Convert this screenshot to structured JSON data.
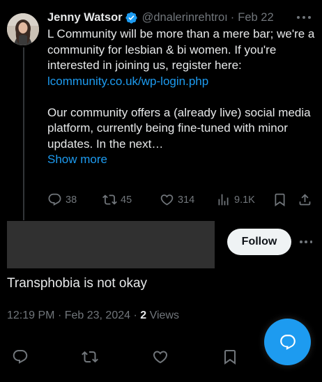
{
  "post": {
    "author_name": "Jenny Watsor",
    "handle": "@dnalerinrehtroı",
    "separator": "·",
    "date": "Feb 22",
    "verified_icon": "verified-badge-icon",
    "body_line_1": "L Community will be more than a mere bar; we're a community for lesbian & bi women. If you're interested in joining us, register here:",
    "link": "lcommunity.co.uk/wp-login.php",
    "body_line_2": "Our community offers a (already live) social media platform, currently being fine-tuned with minor updates. In the next…",
    "show_more": "Show more",
    "actions": {
      "replies": "38",
      "reposts": "45",
      "likes": "314",
      "views": "9.1K"
    }
  },
  "reply": {
    "follow_label": "Follow",
    "text": "Transphobia is not okay",
    "time": "12:19 PM",
    "date": "Feb 23, 2024",
    "separator": "·",
    "views_count": "2",
    "views_label": "Views"
  },
  "colors": {
    "background": "#000000",
    "text": "#e7e9ea",
    "muted": "#71767b",
    "accent": "#1d9bf0",
    "follow_bg": "#eff3f4"
  },
  "icons": [
    "verified-badge-icon",
    "more-icon",
    "reply-icon",
    "repost-icon",
    "like-icon",
    "views-icon",
    "bookmark-icon",
    "share-icon",
    "compose-reply-icon"
  ]
}
